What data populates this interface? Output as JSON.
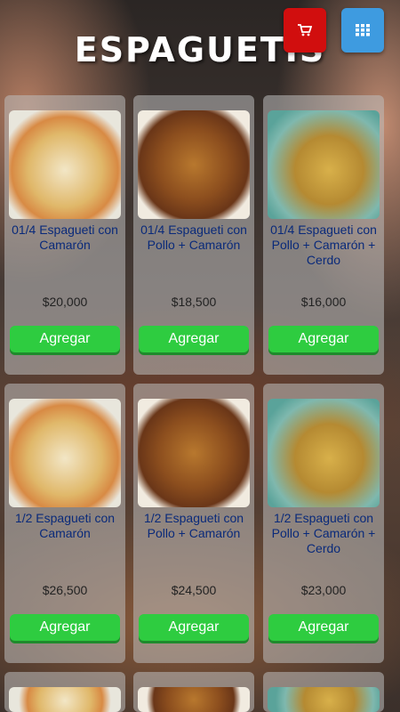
{
  "header": {
    "title": "ESPAGUETIS",
    "cart_icon": "cart-icon",
    "grid_icon": "grid-icon"
  },
  "products": [
    {
      "name": "01/4 Espagueti con Camarón",
      "price": "$20,000",
      "button": "Agregar"
    },
    {
      "name": "01/4 Espagueti con Pollo + Camarón",
      "price": "$18,500",
      "button": "Agregar"
    },
    {
      "name": "01/4 Espagueti con Pollo + Camarón + Cerdo",
      "price": "$16,000",
      "button": "Agregar"
    },
    {
      "name": "1/2 Espagueti con Camarón",
      "price": "$26,500",
      "button": "Agregar"
    },
    {
      "name": "1/2 Espagueti con Pollo + Camarón",
      "price": "$24,500",
      "button": "Agregar"
    },
    {
      "name": "1/2 Espagueti con Pollo + Camarón + Cerdo",
      "price": "$23,000",
      "button": "Agregar"
    }
  ],
  "colors": {
    "cart_button": "#d10e0e",
    "grid_button": "#3e9be0",
    "add_button": "#2ecc40",
    "product_name": "#0a2a7a"
  }
}
